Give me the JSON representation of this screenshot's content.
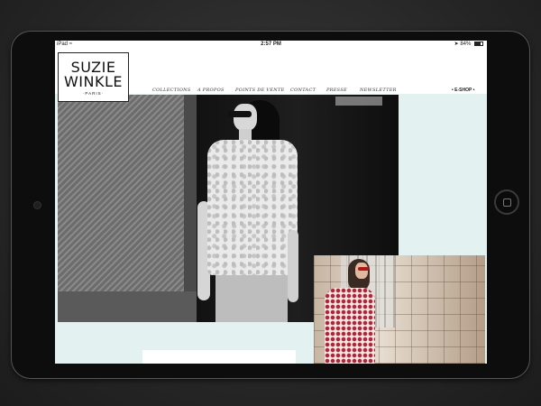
{
  "status_bar": {
    "device": "iPad",
    "wifi_icon": "wifi-icon",
    "time": "2:57 PM",
    "location_icon": "location-arrow-icon",
    "battery": "84%"
  },
  "logo": {
    "line1": "SUZIE",
    "line2": "WINKLE",
    "line3": "PARIS"
  },
  "nav": {
    "items": [
      "COLLECTIONS",
      "A PROPOS",
      "POINTS DE VENTE",
      "CONTACT",
      "PRESSE",
      "NEWSLETTER"
    ],
    "eshop": "E-SHOP"
  },
  "colors": {
    "page_bg": "#e4f1f1",
    "accent": "#b3243a"
  }
}
